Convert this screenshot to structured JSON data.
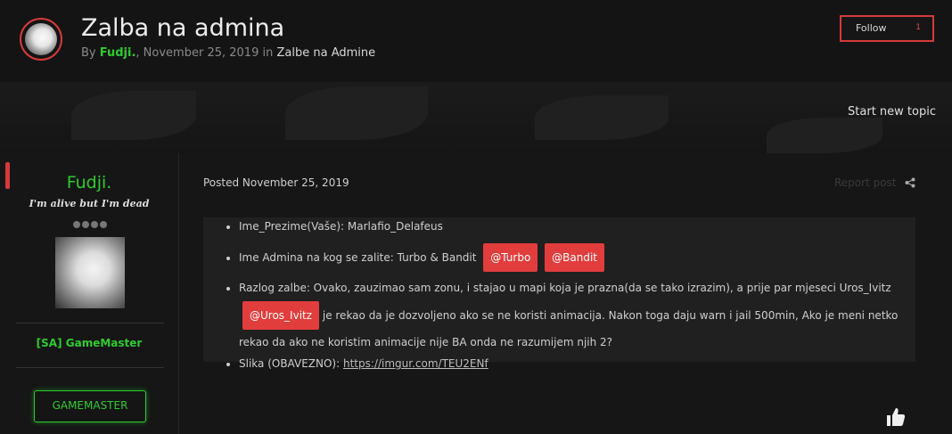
{
  "header": {
    "title": "Zalba na admina",
    "by": "By",
    "author": "Fudji.",
    "date": ", November 25, 2019",
    "in": "in",
    "forum": "Zalbe na Admine",
    "follow_label": "Follow",
    "follow_count": "1"
  },
  "banner": {
    "start_topic": "Start new topic"
  },
  "author_panel": {
    "name": "Fudji.",
    "quote": "I'm alive but I'm dead",
    "group": "[SA] GameMaster",
    "badge": "GAMEMASTER"
  },
  "post": {
    "posted": "Posted November 25, 2019",
    "report": "Report post",
    "items": [
      {
        "text": "Ime_Prezime(Vaše): Marlafio_Delafeus"
      },
      {
        "text": "Ime Admina na kog se zalite: Turbo & Bandit",
        "mentions": [
          "@Turbo",
          "@Bandit"
        ]
      },
      {
        "text_a": "Razlog zalbe: Ovako, zauzimao sam zonu, i stajao u mapi koja je prazna(da se tako izrazim), a prije par mjeseci Uros_Ivitz",
        "mention": "@Uros_Ivitz",
        "text_b": "je rekao da je dozvoljeno ako se ne koristi animacija. Nakon toga daju warn i jail 500min, Ako je meni netko rekao da ako ne koristim animacije nije BA onda ne razumijem njih 2?"
      },
      {
        "label": "Slika (OBAVEZNO):",
        "link": "https://imgur.com/TEU2ENf"
      }
    ]
  },
  "colors": {
    "accent": "#d63a3a",
    "group": "#2ecc2e",
    "mention": "#e23d3d"
  },
  "icons": {
    "share": "share-icon",
    "like": "thumbs-up-icon"
  }
}
